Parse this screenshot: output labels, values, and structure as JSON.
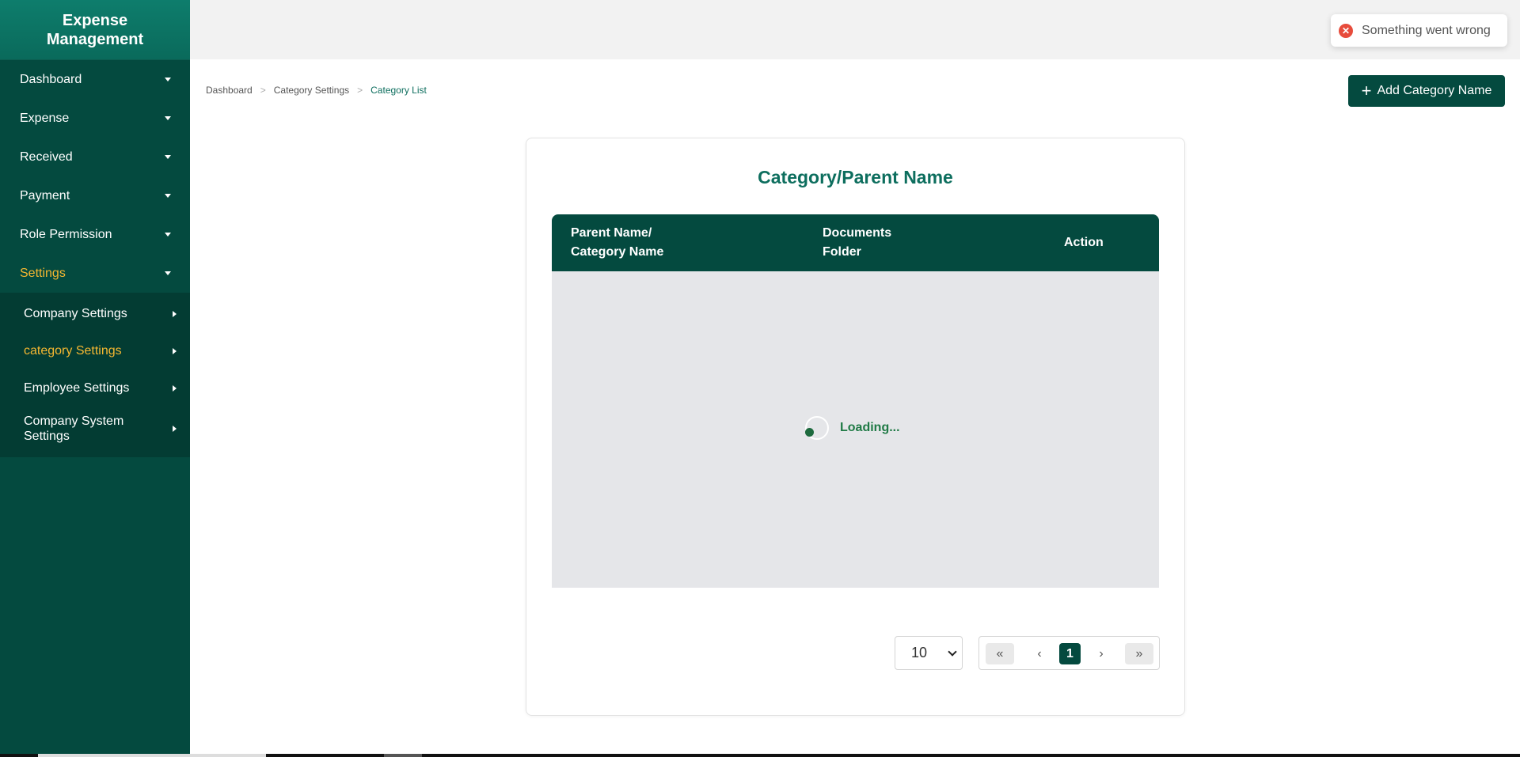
{
  "app": {
    "brand_line1": "Expense",
    "brand_line2": "Management"
  },
  "sidebar": {
    "items": [
      {
        "label": "Dashboard"
      },
      {
        "label": "Expense"
      },
      {
        "label": "Received"
      },
      {
        "label": "Payment"
      },
      {
        "label": "Role Permission"
      },
      {
        "label": "Settings",
        "active": true
      }
    ],
    "settings_submenu": [
      {
        "label": "Company Settings"
      },
      {
        "label": "category Settings",
        "active": true
      },
      {
        "label": "Employee Settings"
      },
      {
        "label": "Company System Settings"
      }
    ]
  },
  "toast": {
    "message": "Something went wrong",
    "type": "error"
  },
  "breadcrumb": [
    "Dashboard",
    "Category Settings",
    "Category List"
  ],
  "header": {
    "add_button_label": "Add Category Name"
  },
  "card": {
    "title": "Category/Parent Name",
    "columns": [
      {
        "line1": "Parent Name/",
        "line2": "Category Name"
      },
      {
        "line1": "Documents",
        "line2": "Folder"
      },
      {
        "line1": "Action"
      }
    ],
    "loading_text": "Loading..."
  },
  "pagination": {
    "page_size": "10",
    "current_page": "1",
    "first_symbol": "«",
    "prev_symbol": "‹",
    "next_symbol": "›",
    "last_symbol": "»"
  },
  "colors": {
    "sidebar_bg": "#044a3f",
    "brand_bg": "#0e7d6c",
    "accent_active": "#f5b731",
    "title_green": "#0d6e5e",
    "error_red": "#e74c3c"
  }
}
